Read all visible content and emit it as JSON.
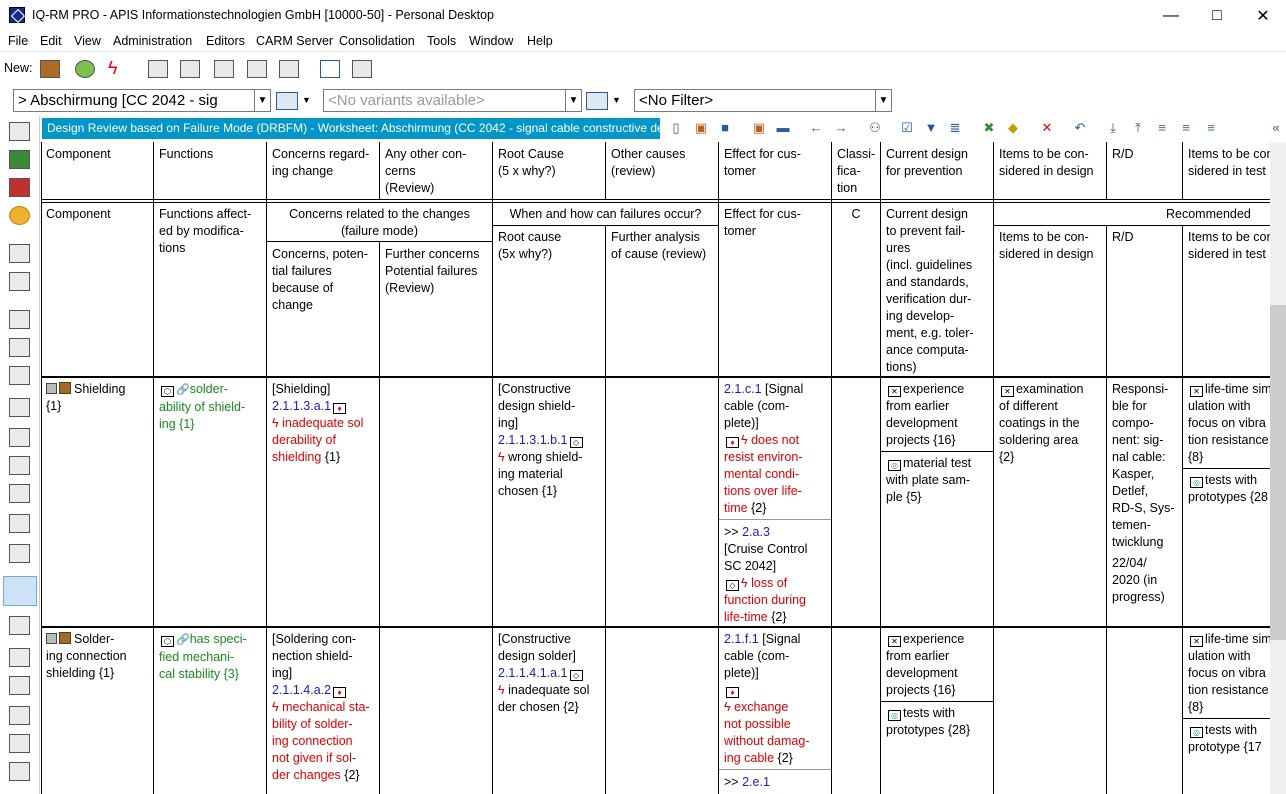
{
  "window": {
    "title": "IQ-RM PRO - APIS Informationstechnologien GmbH [10000-50] - Personal Desktop"
  },
  "menu": [
    "File",
    "Edit",
    "View",
    "Administration",
    "Editors",
    "CARM Server",
    "Consolidation",
    "Tools",
    "Window",
    "Help"
  ],
  "toolbar": {
    "new_label": "New:"
  },
  "combos": {
    "structure": "> Abschirmung [CC 2042 - sig",
    "variants": "<No variants available>",
    "filter": "<No Filter>"
  },
  "worksheet": {
    "title": "Design Review based on Failure Mode (DRBFM) - Worksheet: Abschirmung (CC 2042 - signal cable constructive desi"
  },
  "header1": [
    "Component",
    "Functions",
    "Concerns regard-\ning change",
    "Any other con-\ncerns\n(Review)",
    "Root Cause\n(5 x why?)",
    "Other causes\n(review)",
    "Effect for cus-\ntomer",
    "Classi-\nfica-\ntion",
    "Current design\nfor prevention",
    "Items to be con-\nsidered in design",
    "R/D",
    "Items to be con-\nsidered in test"
  ],
  "header2": {
    "component": "Component",
    "functions": "Functions affect-\ned by modifica-\ntions",
    "concerns_group": "Concerns related to the changes\n(failure mode)",
    "concerns": "Concerns, poten-\ntial failures\nbecause of\nchange",
    "further": "Further concerns\nPotential failures\n(Review)",
    "when_group": "When and how can failures occur?",
    "root": "Root cause\n(5x why?)",
    "further_analysis": "Further analysis\nof cause (review)",
    "effect": "Effect for cus-\ntomer",
    "class": "C",
    "current": "Current design\nto prevent fail-\nures\n(incl. guidelines\nand standards,\nverification dur-\ning develop-\nment, e.g. toler-\nance computa-\ntions)",
    "recommended": "Recommended",
    "items_design": "Items to be con-\nsidered in design",
    "rd": "R/D",
    "items_test": "Items to be con-\nsidered in test"
  },
  "row1": {
    "component": "Shielding",
    "component_count": "{1}",
    "function": "solder-\nability of shield-\ning",
    "function_count": "{1}",
    "concern_ref": "[Shielding]",
    "concern_id": "2.1.1.3.a.1",
    "concern_text": "inadequate sol\nderability of\nshielding",
    "concern_count": "{1}",
    "root_ref": "[Constructive\ndesign shield-\ning]",
    "root_id": "2.1.1.3.1.b.1",
    "root_text": "wrong shield-\ning material\nchosen",
    "root_count": "{1}",
    "effect1_id": "2.1.c.1",
    "effect1_ref": "[Signal\ncable (com-\nplete)]",
    "effect1_text": "does not\nresist environ-\nmental condi-\ntions over life-\ntime",
    "effect1_count": "{2}",
    "effect2_prefix": ">>",
    "effect2_id": "2.a.3",
    "effect2_ref": "[Cruise Control\nSC 2042]",
    "effect2_text": "loss of\nfunction during\nlife-time",
    "effect2_count": "{2}",
    "prev1": "experience\nfrom earlier\ndevelopment\nprojects",
    "prev1_count": "{16}",
    "prev2": "material test\nwith plate sam-\nple ",
    "prev2_count": "{5}",
    "design": "examination\nof different\ncoatings in the\nsoldering area",
    "design_count": "{2}",
    "rd": "Responsi-\nble for\ncompo-\nnent: sig-\nnal cable:\nKasper,\nDetlef,\nRD-S, Sys-\ntemen-\ntwicklung",
    "rd_date": "22/04/\n2020 (in\nprogress)",
    "test1": "life-time sim\nulation with\nfocus on vibra\ntion resistance",
    "test1_count": "{8}",
    "test2": "tests with\nprototypes",
    "test2_count": "{28"
  },
  "row2": {
    "component": "Solder-\ning connection\nshielding",
    "component_count": "{1}",
    "function": "has speci-\nfied mechani-\ncal stability",
    "function_count": "{3}",
    "concern_ref": "[Soldering con-\nnection shield-\ning]",
    "concern_id": "2.1.1.4.a.2",
    "concern_text": "mechanical sta-\nbility of solder-\ning connection\nnot given if sol-\nder changes",
    "concern_count": "{2}",
    "root_ref": "[Constructive\ndesign solder]",
    "root_id": "2.1.1.4.1.a.1",
    "root_text": "inadequate sol\nder chosen",
    "root_count": "{2}",
    "effect1_id": "2.1.f.1",
    "effect1_ref": "[Signal\ncable (com-\nplete)]",
    "effect1_text": "exchange\nnot possible\nwithout damag-\ning cable",
    "effect1_count": "{2}",
    "effect2_prefix": ">>",
    "effect2_id": "2.e.1",
    "prev1": "experience\nfrom earlier\ndevelopment\nprojects",
    "prev1_count": "{16}",
    "prev2": "tests with\nprototypes",
    "prev2_count": "{28}",
    "test1": "life-time sim\nulation with\nfocus on vibra\ntion resistance",
    "test1_count": "{8}",
    "test2": "tests with\nprototype",
    "test2_count": "{17"
  }
}
